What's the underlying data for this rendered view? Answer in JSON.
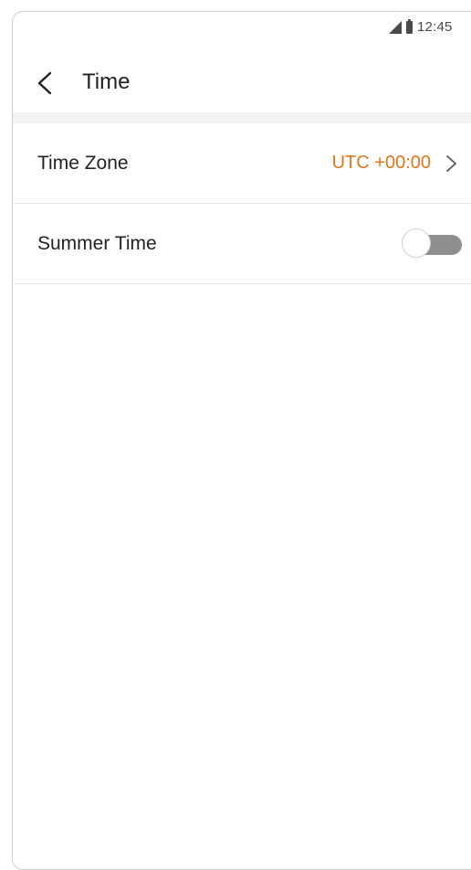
{
  "status_bar": {
    "time": "12:45",
    "icons": [
      "signal-icon",
      "battery-icon"
    ]
  },
  "header": {
    "title": "Time",
    "back_icon": "back-chevron-icon"
  },
  "settings": {
    "time_zone": {
      "label": "Time Zone",
      "value": "UTC +00:00",
      "icon": "chevron-right-icon"
    },
    "summer_time": {
      "label": "Summer Time",
      "enabled": false
    }
  },
  "colors": {
    "accent": "#e0761a",
    "text": "#222222",
    "toggle_off": "#8e8e8e",
    "section_band": "#f2f3f5"
  }
}
